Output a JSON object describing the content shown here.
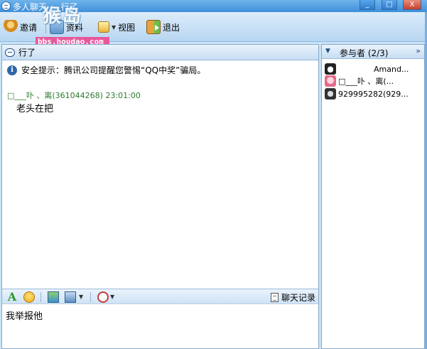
{
  "window": {
    "title": "多人聊天 — 行了",
    "buttons": [
      "_",
      "□",
      "X"
    ]
  },
  "toolbar": {
    "invite_label": "邀请",
    "data_label": "资料",
    "view_label": "视图",
    "exit_label": "退出"
  },
  "watermark": {
    "logo": "猴岛",
    "url": "bbs.houdao.com"
  },
  "chat": {
    "header": "行了",
    "notice": "安全提示：腾讯公司提醒您警惕“QQ中奖”骗局。",
    "messages": [
      {
        "sender": "□___卟 、离(361044268) 23:01:00",
        "text": "老头在把"
      }
    ],
    "history_label": "聊天记录",
    "input_text": "我举报他"
  },
  "members": {
    "header": "参与者 (2/3)",
    "more": "»",
    "list": [
      {
        "name": "Amand...",
        "avatar": "penguin-avatar"
      },
      {
        "name": "□___卟 、离(...",
        "avatar": "girl-avatar"
      },
      {
        "name": "929995282(929...",
        "avatar": "gray-avatar"
      }
    ]
  }
}
